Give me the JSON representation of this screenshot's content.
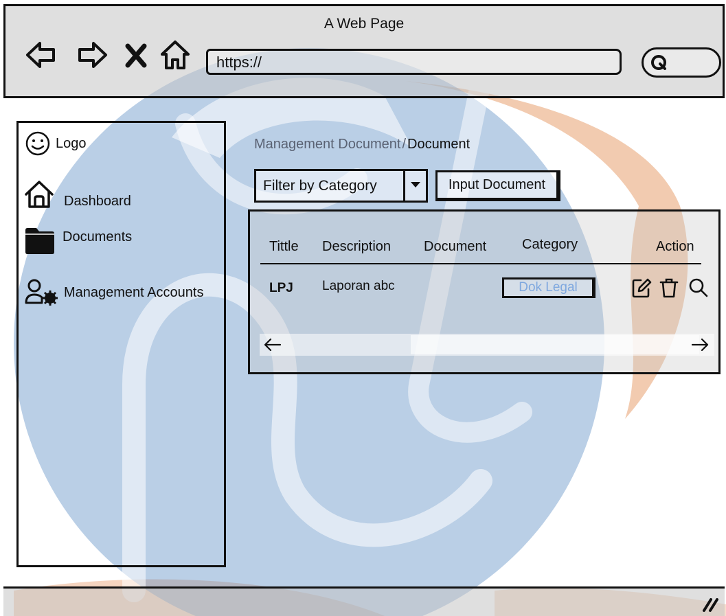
{
  "window": {
    "title": "A Web Page"
  },
  "toolbar": {
    "url_value": "https://"
  },
  "sidebar": {
    "logo_label": "Logo",
    "items": [
      {
        "label": "Dashboard",
        "icon": "home-icon"
      },
      {
        "label": "Documents",
        "icon": "folder-icon"
      },
      {
        "label": "Management Accounts",
        "icon": "user-gear-icon"
      }
    ]
  },
  "breadcrumb": {
    "parent": "Management Document",
    "separator": "/",
    "current": "Document"
  },
  "filter": {
    "label": "Filter by Category"
  },
  "actions": {
    "input_document": "Input Document"
  },
  "table": {
    "columns": [
      "Tittle",
      "Description",
      "Document",
      "Category",
      "Action"
    ],
    "rows": [
      {
        "title": "LPJ",
        "description": "Laporan abc",
        "document": "",
        "category": "Dok Legal"
      }
    ],
    "row_actions": [
      "edit-icon",
      "trash-icon",
      "search-icon"
    ]
  },
  "colors": {
    "chrome": "#c4c4c4",
    "watermark_blue": "#5b8cc4",
    "watermark_orange": "#e8a070",
    "badge_text": "#7fa8df",
    "breadcrumb_parent": "#5a6273"
  }
}
